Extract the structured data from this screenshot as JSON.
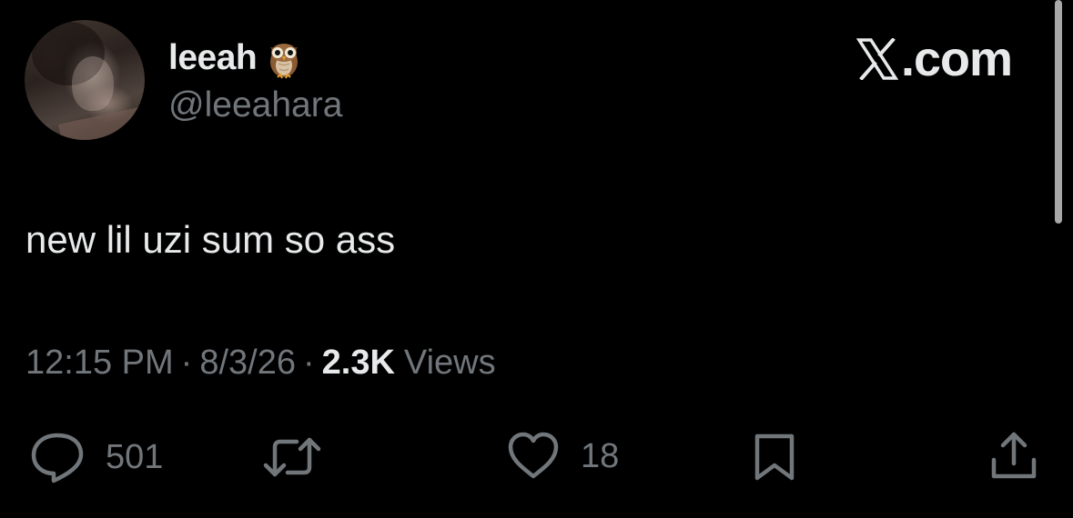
{
  "author": {
    "display_name": "leeah",
    "emoji": "owl-emoji",
    "handle": "@leeahara"
  },
  "brand": {
    "text": ".com"
  },
  "tweet": {
    "text": "new lil uzi sum so ass"
  },
  "meta": {
    "time": "12:15 PM",
    "separator": "·",
    "date": "8/3/26",
    "views_count": "2.3K",
    "views_label": "Views"
  },
  "actions": {
    "reply_count": "501",
    "like_count": "18"
  },
  "colors": {
    "background": "#000000",
    "primary_text": "#e7e9ea",
    "secondary_text": "#71767b"
  }
}
